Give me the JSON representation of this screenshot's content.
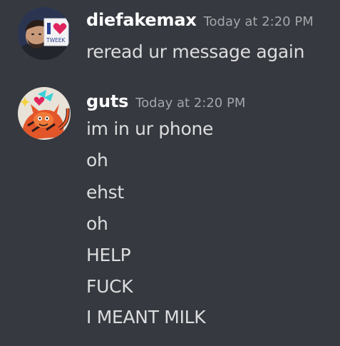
{
  "messages": [
    {
      "username": "diefakemax",
      "timestamp": "Today at 2:20 PM",
      "avatar_text": "TWEEK",
      "lines": [
        "reread ur message again"
      ]
    },
    {
      "username": "guts",
      "timestamp": "Today at 2:20 PM",
      "lines": [
        "im in ur phone",
        "oh",
        "ehst",
        "oh",
        "HELP",
        "FUCK",
        "I MEANT MILK"
      ]
    }
  ],
  "colors": {
    "background": "#36393f",
    "username": "#ffffff",
    "timestamp": "#a3a6aa",
    "message": "#dcddde"
  }
}
